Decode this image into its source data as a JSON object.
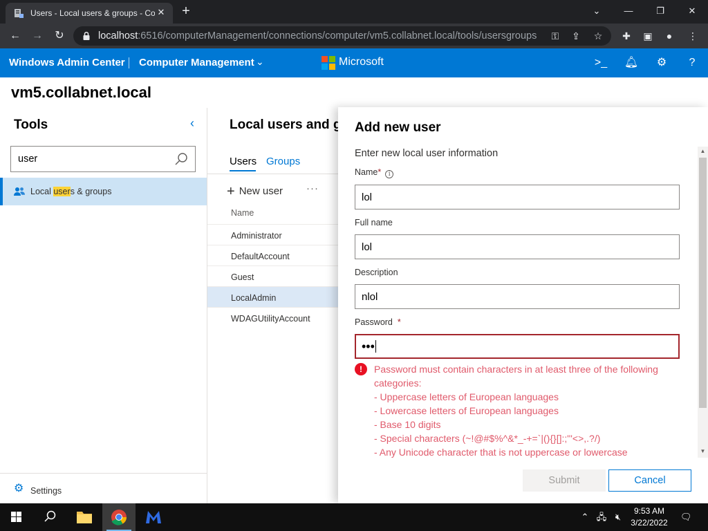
{
  "browser": {
    "tab_title": "Users - Local users & groups - Computer Management",
    "url_host": "localhost",
    "url_rest": ":6516/computerManagement/connections/computer/vm5.collabnet.local/tools/usersgroups",
    "icons": [
      "back-icon",
      "forward-icon",
      "reload-icon",
      "lock-icon",
      "key-icon",
      "share-icon",
      "star-icon",
      "extensions-icon",
      "sidebar-icon",
      "profile-icon",
      "menu-icon"
    ]
  },
  "header": {
    "brand": "Windows Admin Center",
    "mode": "Computer Management",
    "company": "Microsoft",
    "brand_color": "#0078d4"
  },
  "server": {
    "name": "vm5.collabnet.local"
  },
  "tools": {
    "title": "Tools",
    "search_value": "user",
    "item_label_before": "Local ",
    "item_label_match": "user",
    "item_label_after": "s & groups",
    "settings_label": "Settings"
  },
  "main": {
    "title": "Local users and groups",
    "tabs": [
      {
        "label": "Users"
      },
      {
        "label": "Groups"
      }
    ],
    "new_user_label": "New user",
    "more_label": "···",
    "column_name": "Name",
    "rows": [
      "Administrator",
      "DefaultAccount",
      "Guest",
      "LocalAdmin",
      "WDAGUtilityAccount"
    ],
    "selected_row": "LocalAdmin"
  },
  "panel": {
    "title": "Add new user",
    "subtitle": "Enter new local user information",
    "name_label": "Name",
    "name_value": "lol",
    "fullname_label": "Full name",
    "fullname_value": "lol",
    "description_label": "Description",
    "description_value": "nlol",
    "password_label": "Password",
    "password_value": "•••",
    "required_marker": "*",
    "error_lines": [
      "Password must contain characters in at least three of the following",
      "categories:",
      "- Uppercase letters of European languages",
      "- Lowercase letters of European languages",
      "- Base 10 digits",
      "- Special characters (~!@#$%^&*_-+=`|(){}[]:;\"'<>,.?/)",
      "- Any Unicode character that is not uppercase or lowercase"
    ],
    "error_color": "#a4262c",
    "submit_label": "Submit",
    "cancel_label": "Cancel"
  },
  "taskbar": {
    "time": "9:53 AM",
    "date": "3/22/2022"
  }
}
